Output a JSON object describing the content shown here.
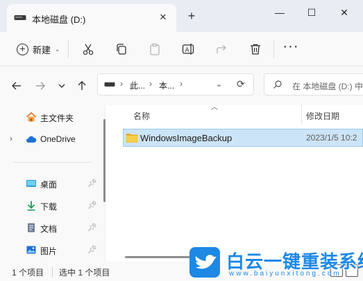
{
  "window": {
    "tab_title": "本地磁盘 (D:)",
    "add_tab_label": "+",
    "close_tab_label": "✕",
    "minimize_label": "—",
    "maximize_label": "☐",
    "close_label": "✕"
  },
  "toolbar": {
    "new_label": "新建",
    "more_label": "···"
  },
  "address": {
    "crumbs": [
      "此...",
      "本..."
    ],
    "search_placeholder": "在 本地磁盘 (D:) 中搜索"
  },
  "sidebar": {
    "items": [
      {
        "label": "主文件夹",
        "icon": "home-icon"
      },
      {
        "label": "OneDrive",
        "icon": "cloud-icon"
      },
      {
        "label": "桌面",
        "icon": "desktop-icon",
        "pinned": true
      },
      {
        "label": "下载",
        "icon": "download-icon",
        "pinned": true
      },
      {
        "label": "文档",
        "icon": "document-icon",
        "pinned": true
      },
      {
        "label": "图片",
        "icon": "picture-icon",
        "pinned": true
      }
    ]
  },
  "list": {
    "columns": {
      "name": "名称",
      "date": "修改日期"
    },
    "rows": [
      {
        "name": "WindowsImageBackup",
        "date": "2023/1/5 10:2",
        "selected": true
      }
    ]
  },
  "status": {
    "item_count": "1 个项目",
    "selected": "选中 1 个项目"
  },
  "watermark": {
    "title": "白云一键重装系统",
    "url": "www.baiyunxitong.com"
  },
  "colors": {
    "accent": "#1e88e5",
    "selection": "#cce4f7",
    "folder": "#f4c542"
  }
}
